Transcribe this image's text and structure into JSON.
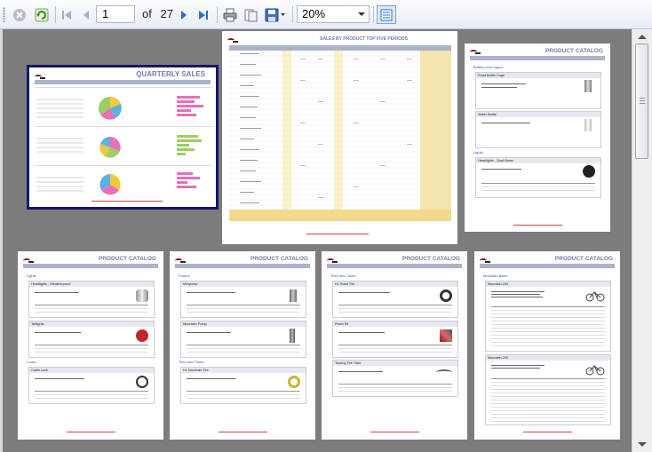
{
  "toolbar": {
    "stop_icon": "stop-icon",
    "refresh_icon": "refresh-icon",
    "page_input": "1",
    "of_label": "of",
    "total_pages": "27",
    "zoom_value": "20%",
    "colors": {
      "accent": "#2b6fd6",
      "toolbar_bg": "#eef2f8"
    }
  },
  "pages": {
    "p1_title": "QUARTERLY SALES",
    "p2_title": "SALES BY PRODUCT TOP FIVE PERIODS",
    "catalog_title": "PRODUCT CATALOG",
    "p3_section": "Bottles and Cages",
    "p3_prod1": "Road Bottle Cage",
    "p3_prod2": "Water Bottle",
    "p3_section2": "Lights",
    "p3_prod3": "Headlights - Dual-Beam",
    "p4_section": "Lights",
    "p4_prod1": "Headlights - Weatherproof",
    "p4_prod2": "Taillights",
    "p4_section2": "Locks",
    "p4_prod3": "Cable Lock",
    "p5_section": "Pumps",
    "p5_prod1": "Minipump",
    "p5_prod2": "Mountain Pump",
    "p5_section2": "Tires and Tubes",
    "p5_prod3": "HL Mountain Tire",
    "p6_section": "Tires and Tubes",
    "p6_prod1": "HL Road Tire",
    "p6_prod2": "Patch Kit",
    "p6_prod3": "Touring Tire Tube",
    "p7_section": "Mountain Bikes",
    "p7_prod1": "Mountain-100",
    "p7_prod2": "Mountain-200"
  }
}
